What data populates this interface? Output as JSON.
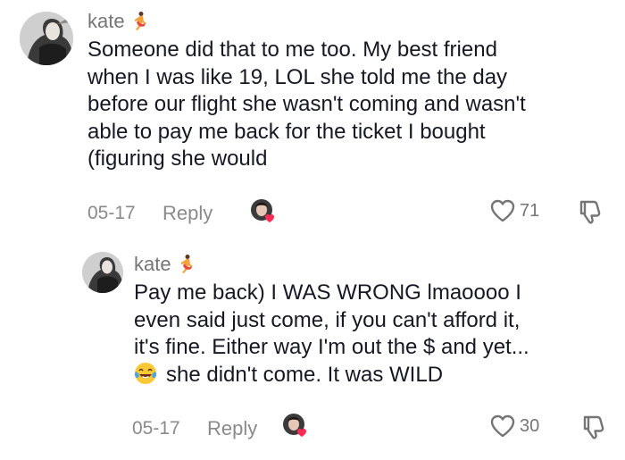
{
  "comments": [
    {
      "username": "kate",
      "text_lines": [
        "Someone did that to me too. My best friend",
        "when I was like 19, LOL she told me the day",
        "before our flight she wasn't coming and wasn't",
        "able to pay me back for the ticket I bought",
        "(figuring she would"
      ],
      "date": "05-17",
      "reply_label": "Reply",
      "like_count": "71"
    },
    {
      "username": "kate",
      "text_lines": [
        "Pay me back) I WAS WRONG lmaoooo I",
        "even said just come, if you can't afford it,",
        "it's fine. Either way I'm out the $ and yet...",
        "she didn't come. It was WILD"
      ],
      "date": "05-17",
      "reply_label": "Reply",
      "like_count": "30"
    }
  ],
  "icons": {
    "username_emoji": "dancer-emoji-icon",
    "laugh_emoji": "laughing-tears-emoji-icon",
    "like": "heart-outline-icon",
    "dislike": "thumbs-down-icon",
    "creator_liked": "creator-liked-avatar-icon"
  },
  "colors": {
    "heart_accent": "#fe2c55",
    "secondary_text": "#8a8a8a"
  }
}
